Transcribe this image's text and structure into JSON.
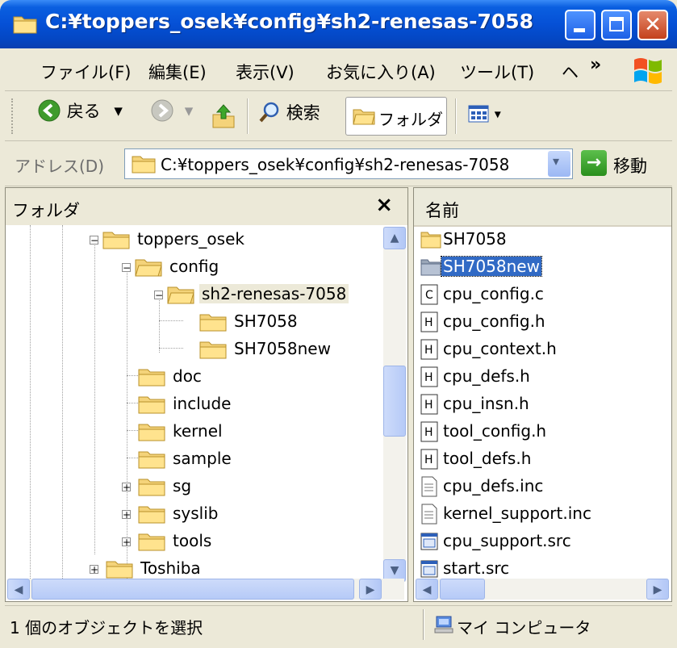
{
  "window": {
    "title": "C:¥toppers_osek¥config¥sh2-renesas-7058",
    "close_glyph": "✕"
  },
  "menu": {
    "items": [
      "ファイル(F)",
      "編集(E)",
      "表示(V)",
      "お気に入り(A)",
      "ツール(T)",
      "ヘ"
    ],
    "more": "»"
  },
  "toolbar": {
    "back_label": "戻る",
    "search_label": "検索",
    "folders_label": "フォルダ",
    "dropdown_glyph": "▾"
  },
  "address": {
    "label": "アドレス(D)",
    "value": "C:¥toppers_osek¥config¥sh2-renesas-7058",
    "dropdown_glyph": "▾",
    "go_arrow": "→",
    "go_label": "移動"
  },
  "folder_pane": {
    "title": "フォルダ",
    "close_glyph": "×",
    "tree": [
      {
        "label": "toppers_osek",
        "expander": "−"
      },
      {
        "label": "config",
        "expander": "−"
      },
      {
        "label": "sh2-renesas-7058",
        "expander": "−",
        "selected": true
      },
      {
        "label": "SH7058",
        "expander": ""
      },
      {
        "label": "SH7058new",
        "expander": ""
      },
      {
        "label": "doc",
        "expander": ""
      },
      {
        "label": "include",
        "expander": ""
      },
      {
        "label": "kernel",
        "expander": ""
      },
      {
        "label": "sample",
        "expander": ""
      },
      {
        "label": "sg",
        "expander": "+"
      },
      {
        "label": "syslib",
        "expander": "+"
      },
      {
        "label": "tools",
        "expander": "+"
      },
      {
        "label": "Toshiba",
        "expander": "+"
      }
    ]
  },
  "file_pane": {
    "column_name": "名前",
    "files": [
      {
        "name": "SH7058",
        "icon": "folder-icon"
      },
      {
        "name": "SH7058new",
        "icon": "folder-icon",
        "selected": true
      },
      {
        "name": "cpu_config.c",
        "icon": "c-file-icon"
      },
      {
        "name": "cpu_config.h",
        "icon": "h-file-icon"
      },
      {
        "name": "cpu_context.h",
        "icon": "h-file-icon"
      },
      {
        "name": "cpu_defs.h",
        "icon": "h-file-icon"
      },
      {
        "name": "cpu_insn.h",
        "icon": "h-file-icon"
      },
      {
        "name": "tool_config.h",
        "icon": "h-file-icon"
      },
      {
        "name": "tool_defs.h",
        "icon": "h-file-icon"
      },
      {
        "name": "cpu_defs.inc",
        "icon": "text-file-icon"
      },
      {
        "name": "kernel_support.inc",
        "icon": "text-file-icon"
      },
      {
        "name": "cpu_support.src",
        "icon": "src-file-icon"
      },
      {
        "name": "start.src",
        "icon": "src-file-icon"
      }
    ]
  },
  "status": {
    "left": "1 個のオブジェクトを選択",
    "right": "マイ コンピュータ"
  },
  "scroll": {
    "up": "▲",
    "down": "▼",
    "left": "◀",
    "right": "▶"
  }
}
